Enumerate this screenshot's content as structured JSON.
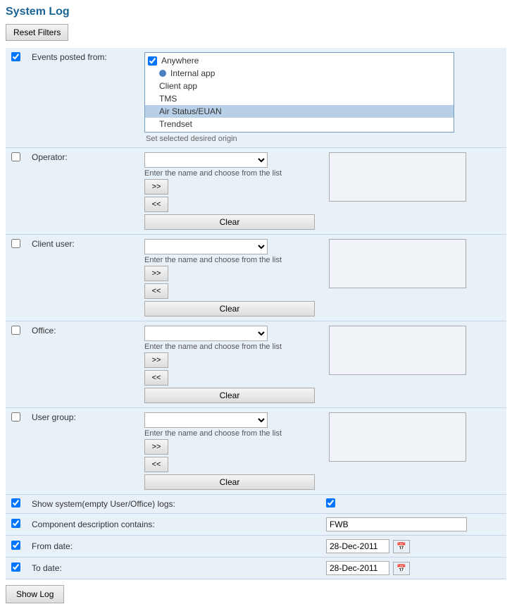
{
  "title": "System Log",
  "resetButton": "Reset Filters",
  "showLogButton": "Show Log",
  "events": {
    "label": "Events posted from:",
    "items": [
      {
        "id": "anywhere",
        "label": "Anywhere",
        "type": "checkbox",
        "checked": true
      },
      {
        "id": "internal",
        "label": "Internal app",
        "type": "radio",
        "checked": true
      },
      {
        "id": "client",
        "label": "Client app",
        "type": "none"
      },
      {
        "id": "tms",
        "label": "TMS",
        "type": "none"
      },
      {
        "id": "airstatus",
        "label": "Air Status/EUAN",
        "type": "none",
        "highlighted": true
      },
      {
        "id": "trendset",
        "label": "Trendset",
        "type": "none"
      }
    ],
    "hint": "Set selected desired origin"
  },
  "operator": {
    "label": "Operator:",
    "hint": "Enter the name and choose from the list",
    "forwardBtn": ">>",
    "backBtn": "<<",
    "clearBtn": "Clear"
  },
  "clientUser": {
    "label": "Client user:",
    "hint": "Enter the name and choose from the list",
    "forwardBtn": ">>",
    "backBtn": "<<",
    "clearBtn": "Clear"
  },
  "office": {
    "label": "Office:",
    "hint": "Enter the name and choose from the list",
    "forwardBtn": ">>",
    "backBtn": "<<",
    "clearBtn": "Clear"
  },
  "userGroup": {
    "label": "User group:",
    "hint": "Enter the name and choose from the list",
    "forwardBtn": ">>",
    "backBtn": "<<",
    "clearBtn": "Clear"
  },
  "showSystem": {
    "label": "Show system(empty User/Office) logs:",
    "checked": true
  },
  "componentDesc": {
    "label": "Component description contains:",
    "value": "FWB"
  },
  "fromDate": {
    "label": "From date:",
    "value": "28-Dec-2011"
  },
  "toDate": {
    "label": "To date:",
    "value": "28-Dec-2011"
  }
}
